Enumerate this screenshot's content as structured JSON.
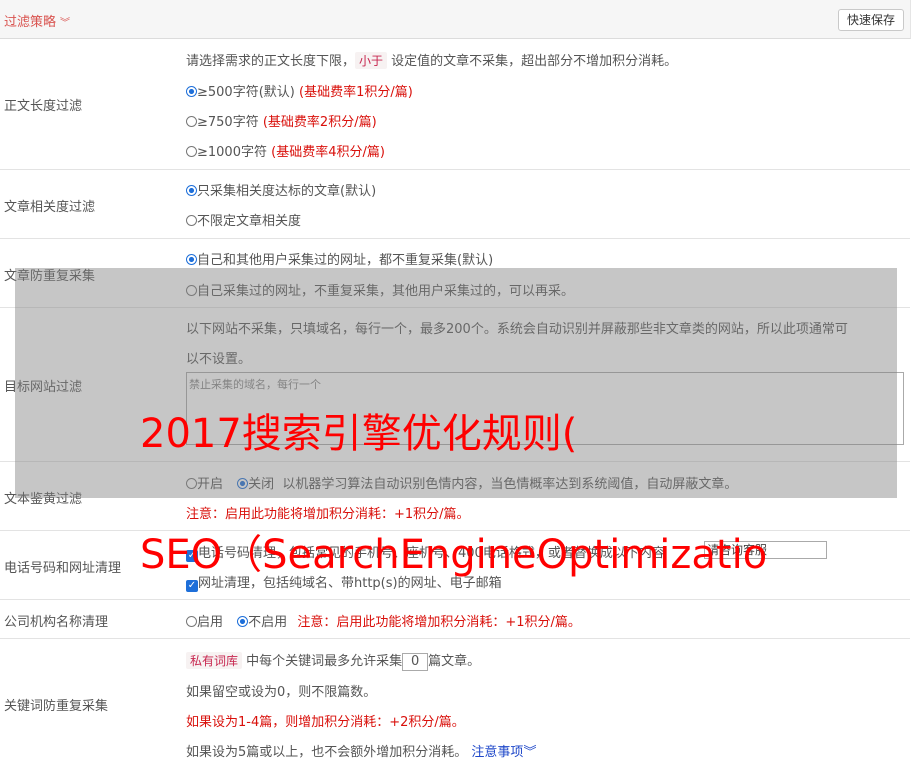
{
  "header": {
    "title": "过滤策略",
    "save_label": "快速保存"
  },
  "length_filter": {
    "label": "正文长度过滤",
    "desc_prefix": "请选择需求的正文长度下限，",
    "desc_tag": "小于",
    "desc_suffix": "设定值的文章不采集，超出部分不增加积分消耗。",
    "options": [
      {
        "text": "≥500字符(默认)",
        "note": "(基础费率1积分/篇)"
      },
      {
        "text": "≥750字符",
        "note": "(基础费率2积分/篇)"
      },
      {
        "text": "≥1000字符",
        "note": "(基础费率4积分/篇)"
      }
    ]
  },
  "relevance": {
    "label": "文章相关度过滤",
    "options": [
      "只采集相关度达标的文章(默认)",
      "不限定文章相关度"
    ]
  },
  "dedupe": {
    "label": "文章防重复采集",
    "options": [
      "自己和其他用户采集过的网址，都不重复采集(默认)",
      "自己采集过的网址，不重复采集，其他用户采集过的，可以再采。"
    ]
  },
  "site_filter": {
    "label": "目标网站过滤",
    "desc_line1": "以下网站不采集，只填域名，每行一个，最多200个。系统会自动识别并屏蔽那些非文章类的网站，所以此项通常可",
    "desc_line2": "以不设置。",
    "placeholder": "禁止采集的域名，每行一个"
  },
  "porn_filter": {
    "label": "文本鉴黄过滤",
    "off": "开启",
    "on": "关闭",
    "desc": "以机器学习算法自动识别色情内容，当色情概率达到系统阈值，自动屏蔽文章。",
    "warning": "注意：启用此功能将增加积分消耗：+1积分/篇。"
  },
  "phone_clean": {
    "label": "电话号码和网址清理",
    "phone_text": "电话号码清理，包括常见的手机号、座机号、400电话格式，或者替换成以下内容",
    "phone_value": "请咨询客服",
    "url_text": "网址清理，包括纯域名、带http(s)的网址、电子邮箱"
  },
  "org_clean": {
    "label": "公司机构名称清理",
    "enable": "启用",
    "disable": "不启用",
    "warning": "注意：启用此功能将增加积分消耗：+1积分/篇。"
  },
  "keyword": {
    "label": "关键词防重复采集",
    "tag": "私有词库",
    "line1_mid": "中每个关键词最多允许采集",
    "count": "0",
    "line1_end": "篇文章。",
    "line2": "如果留空或设为0，则不限篇数。",
    "line3": "如果设为1-4篇，则增加积分消耗：+2积分/篇。",
    "line4": "如果设为5篇或以上，也不会额外增加积分消耗。",
    "notes_link": "注意事项"
  },
  "watermark": {
    "line1": "2017搜索引擎优化规则(",
    "line2": "SEO（SearchEngineOptimizatio"
  }
}
